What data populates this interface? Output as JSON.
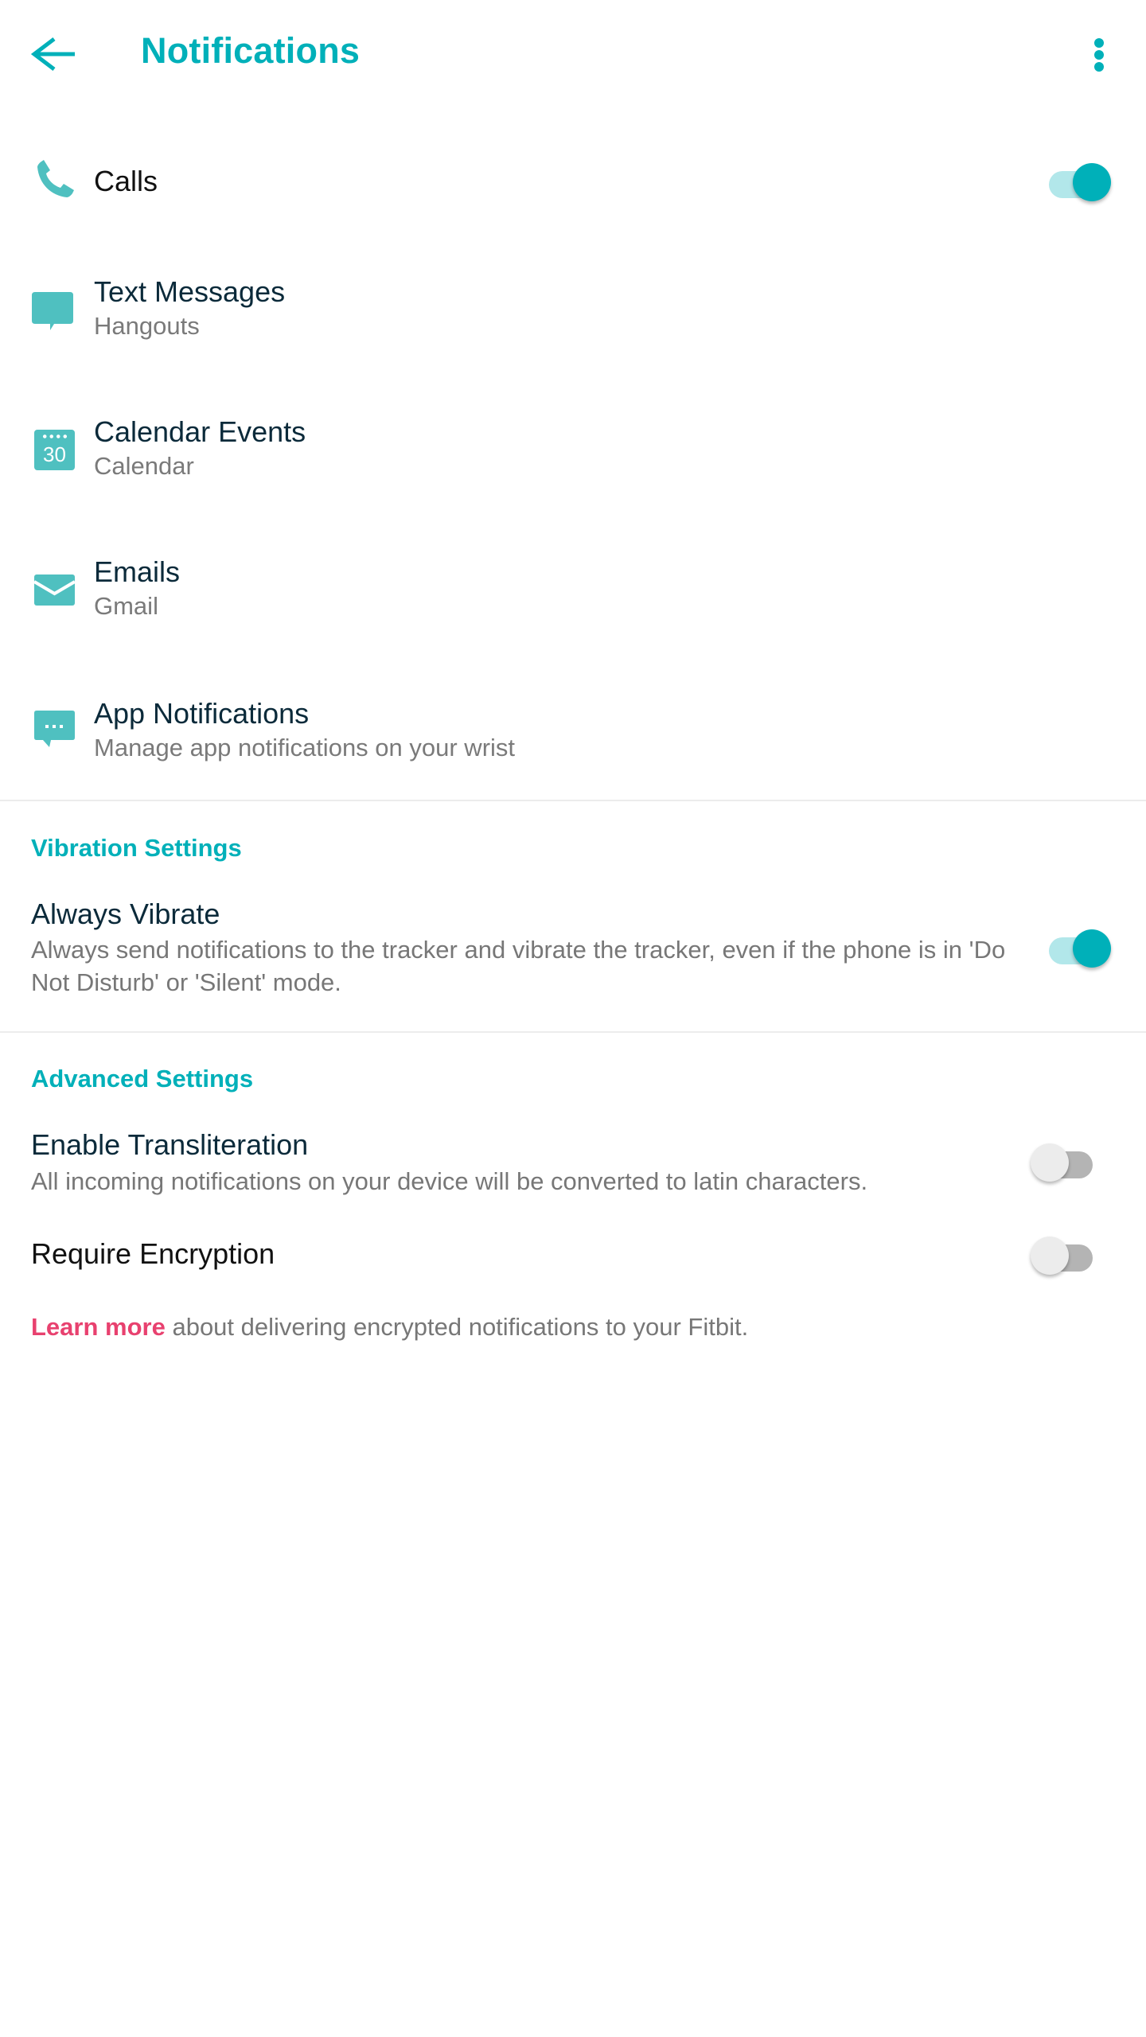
{
  "header": {
    "title": "Notifications",
    "back_icon": "arrow-left-icon",
    "menu_icon": "more-vertical-icon"
  },
  "colors": {
    "accent": "#00b0b9",
    "icon": "#4fc0c0",
    "link": "#e8416f",
    "toggle_on_track": "#b2e7ea",
    "toggle_off_track": "#b4b4b4",
    "toggle_off_thumb": "#ececec"
  },
  "notification_items": [
    {
      "title": "Calls",
      "subtitle": null,
      "icon": "phone-icon",
      "toggle": true
    },
    {
      "title": "Text Messages",
      "subtitle": "Hangouts",
      "icon": "message-bubble-icon"
    },
    {
      "title": "Calendar Events",
      "subtitle": "Calendar",
      "icon": "calendar-icon",
      "icon_text": "30"
    },
    {
      "title": "Emails",
      "subtitle": "Gmail",
      "icon": "envelope-icon"
    },
    {
      "title": "App Notifications",
      "subtitle": "Manage app notifications on your wrist",
      "icon": "app-message-icon"
    }
  ],
  "vibration_settings": {
    "header": "Vibration Settings",
    "always_vibrate": {
      "title": "Always Vibrate",
      "description": "Always send notifications to the tracker and vibrate the tracker, even if the phone is in 'Do Not Disturb' or 'Silent' mode.",
      "enabled": true
    }
  },
  "advanced_settings": {
    "header": "Advanced Settings",
    "transliteration": {
      "title": "Enable Transliteration",
      "description": "All incoming notifications on your device will be converted to latin characters.",
      "enabled": false
    },
    "encryption": {
      "title": "Require Encryption",
      "enabled": false
    },
    "learn_more": {
      "link_text": "Learn more",
      "text": " about delivering encrypted notifications to your Fitbit."
    }
  }
}
